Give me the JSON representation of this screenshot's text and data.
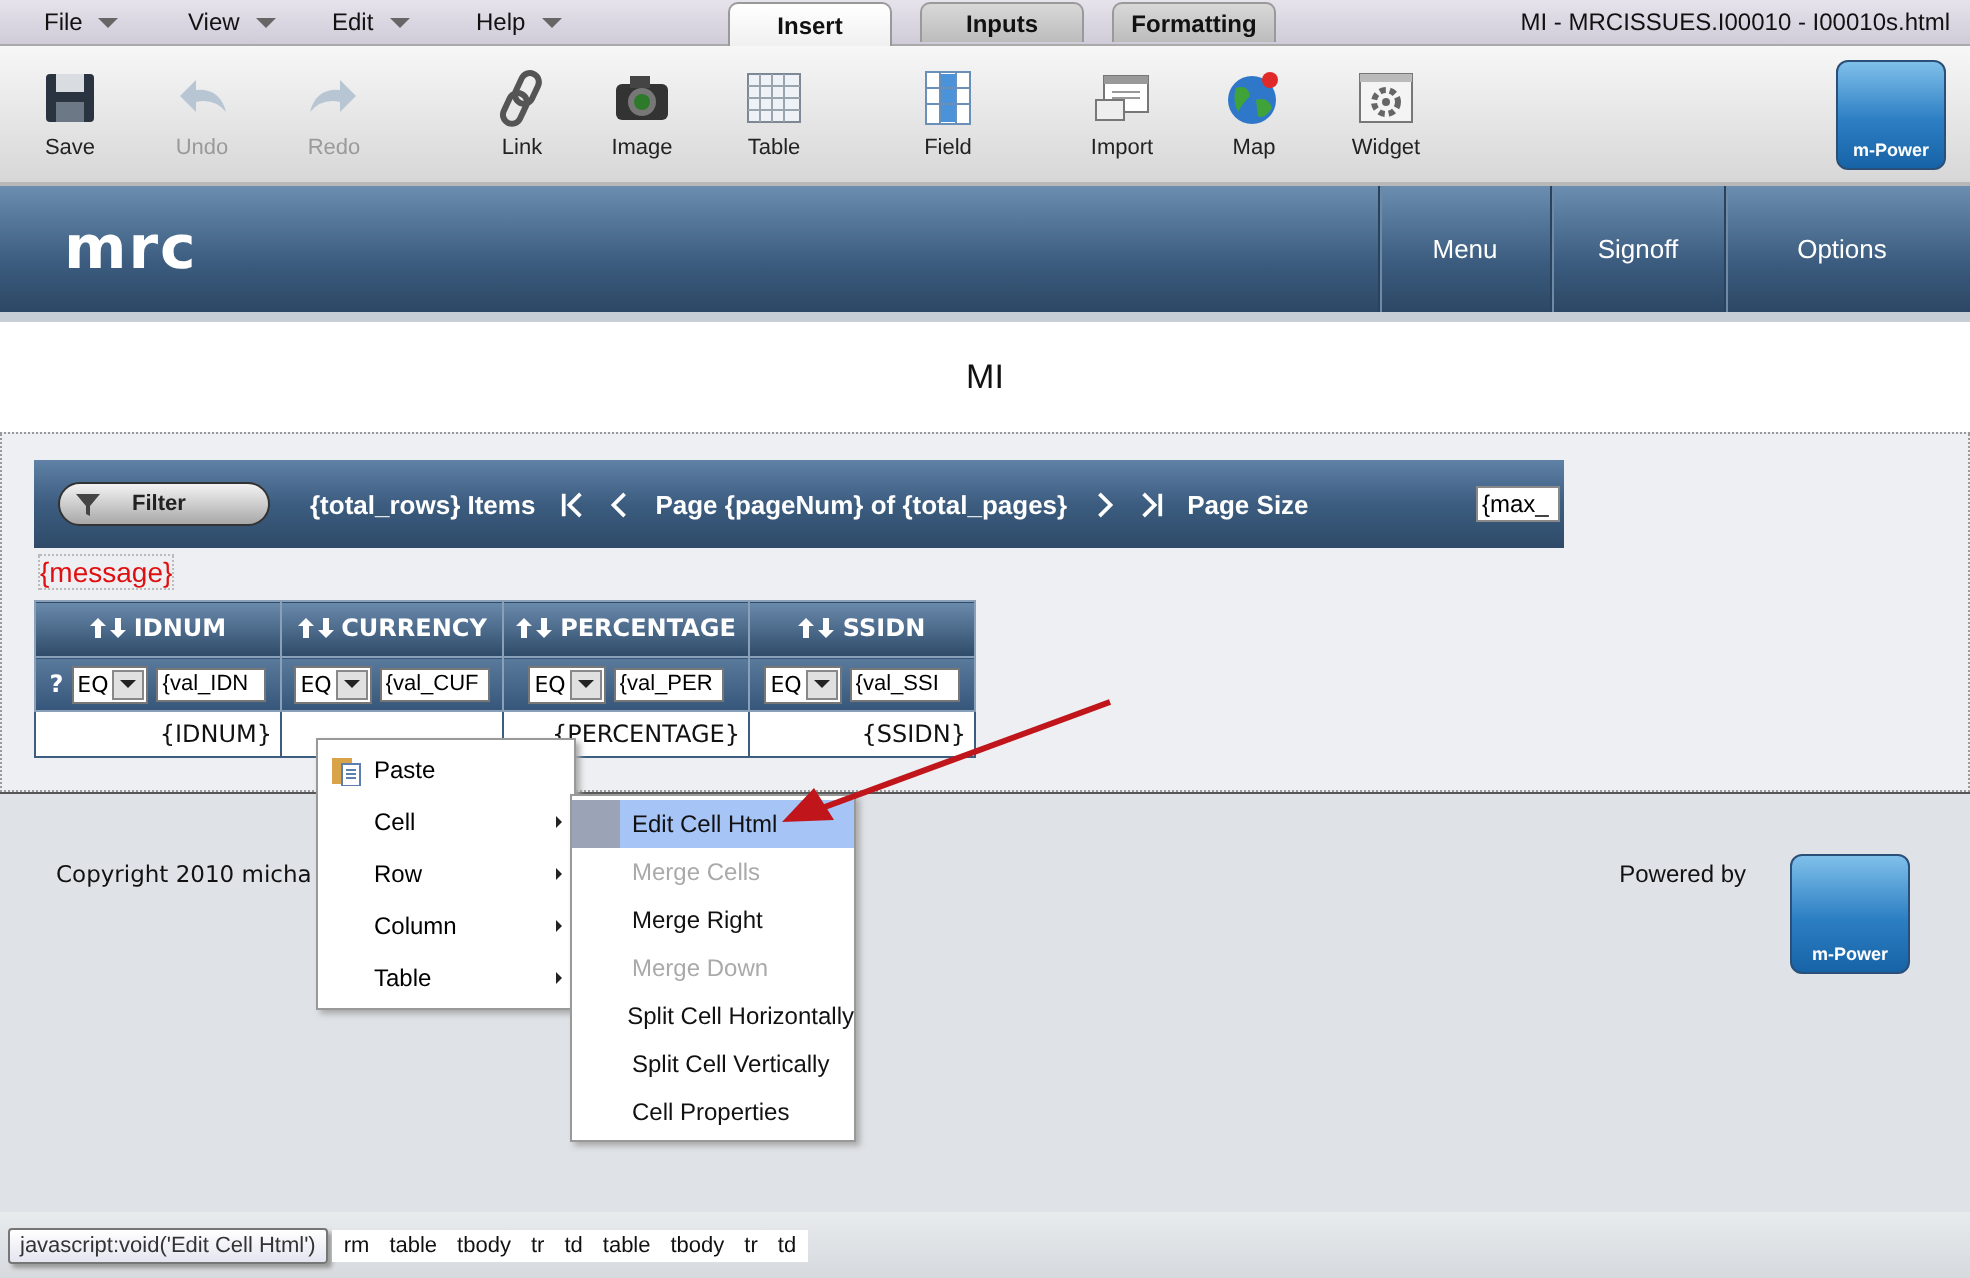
{
  "menubar": {
    "menus": [
      {
        "label": "File"
      },
      {
        "label": "View"
      },
      {
        "label": "Edit"
      },
      {
        "label": "Help"
      }
    ],
    "tabs": [
      {
        "label": "Insert",
        "selected": true
      },
      {
        "label": "Inputs",
        "selected": false
      },
      {
        "label": "Formatting",
        "selected": false
      }
    ],
    "title": "MI - MRCISSUES.I00010 - I00010s.html"
  },
  "toolbar": {
    "items": [
      {
        "kind": "save",
        "label": "Save",
        "disabled": false
      },
      {
        "kind": "undo",
        "label": "Undo",
        "disabled": true
      },
      {
        "kind": "redo",
        "label": "Redo",
        "disabled": true
      },
      {
        "kind": "link",
        "label": "Link",
        "disabled": false
      },
      {
        "kind": "image",
        "label": "Image",
        "disabled": false
      },
      {
        "kind": "table",
        "label": "Table",
        "disabled": false
      },
      {
        "kind": "field",
        "label": "Field",
        "disabled": false
      },
      {
        "kind": "import",
        "label": "Import",
        "disabled": false
      },
      {
        "kind": "map",
        "label": "Map",
        "disabled": false
      },
      {
        "kind": "widget",
        "label": "Widget",
        "disabled": false
      }
    ],
    "logo": "m-Power"
  },
  "header": {
    "brand": "mrc",
    "nav": [
      {
        "label": "Menu"
      },
      {
        "label": "Signoff"
      },
      {
        "label": "Options"
      }
    ]
  },
  "page_title": "MI",
  "grid_bar": {
    "filter": "Filter",
    "items": "{total_rows} Items",
    "page": "Page {pageNum} of {total_pages}",
    "page_size": "Page Size",
    "page_size_value": "{max_"
  },
  "message": "{message}",
  "table": {
    "columns": [
      {
        "label": "IDNUM",
        "op": "EQ",
        "value": "{val_IDN",
        "cell": "{IDNUM}"
      },
      {
        "label": "CURRENCY",
        "op": "EQ",
        "value": "{val_CUF"
      },
      {
        "label": "PERCENTAGE",
        "op": "EQ",
        "value": "{val_PER",
        "cell": "{PERCENTAGE}"
      },
      {
        "label": "SSIDN",
        "op": "EQ",
        "value": "{val_SSI",
        "cell": "{SSIDN}"
      }
    ],
    "help": "?"
  },
  "footer": {
    "copyright": "Copyright 2010 micha",
    "powered_by": "Powered by",
    "logo": "m-Power"
  },
  "context_menu": {
    "items": [
      {
        "label": "Paste",
        "icon": true,
        "submenu": false,
        "selected": false
      },
      {
        "label": "Cell",
        "icon": false,
        "submenu": true,
        "selected": false
      },
      {
        "label": "Row",
        "icon": false,
        "submenu": true,
        "selected": false
      },
      {
        "label": "Column",
        "icon": false,
        "submenu": true,
        "selected": false
      },
      {
        "label": "Table",
        "icon": false,
        "submenu": true,
        "selected": false
      }
    ],
    "submenu": [
      {
        "label": "Edit Cell Html",
        "disabled": false,
        "selected": true
      },
      {
        "label": "Merge Cells",
        "disabled": true,
        "selected": false
      },
      {
        "label": "Merge Right",
        "disabled": false,
        "selected": false
      },
      {
        "label": "Merge Down",
        "disabled": true,
        "selected": false
      },
      {
        "label": "Split Cell Horizontally",
        "disabled": false,
        "selected": false
      },
      {
        "label": "Split Cell Vertically",
        "disabled": false,
        "selected": false
      },
      {
        "label": "Cell Properties",
        "disabled": false,
        "selected": false
      }
    ]
  },
  "status_bar": {
    "tooltip": "javascript:void('Edit Cell Html')",
    "breadcrumbs": [
      "rm",
      "table",
      "tbody",
      "tr",
      "td",
      "table",
      "tbody",
      "tr",
      "td"
    ]
  }
}
